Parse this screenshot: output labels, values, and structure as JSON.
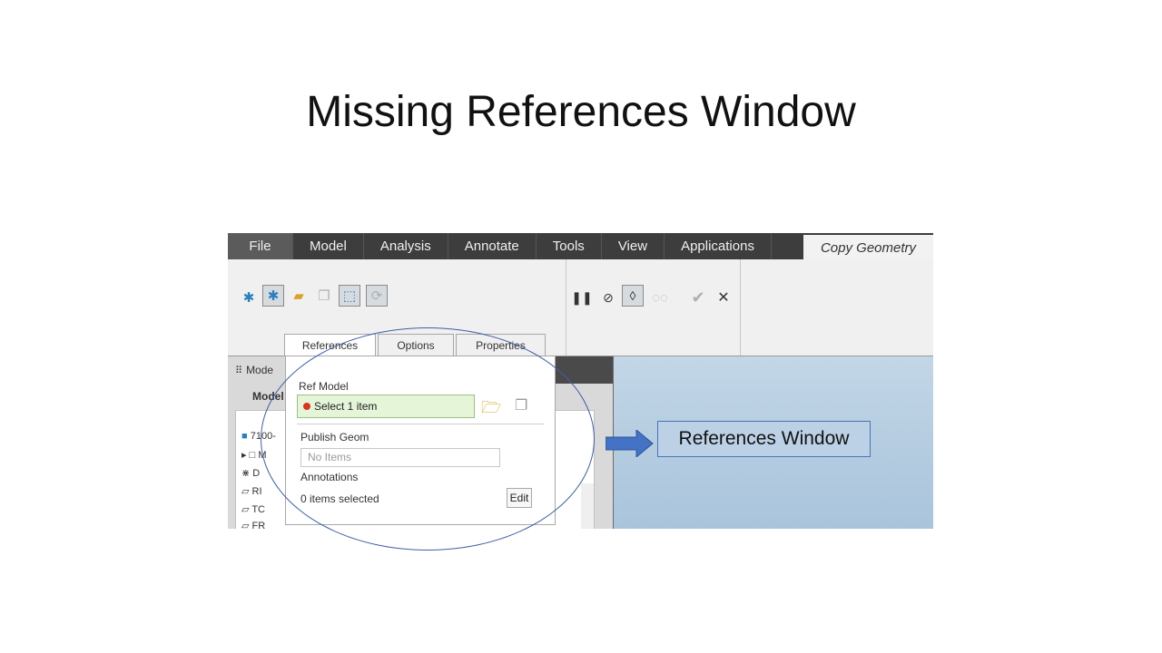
{
  "slide": {
    "title": "Missing References Window"
  },
  "menu": {
    "items": [
      "File",
      "Model",
      "Analysis",
      "Annotate",
      "Tools",
      "View",
      "Applications"
    ],
    "active": "Copy Geometry"
  },
  "ribbon": {
    "tabs": [
      "References",
      "Options",
      "Properties"
    ]
  },
  "tree": {
    "header": "Mode",
    "sub": "Model",
    "rows": [
      "7100-",
      "M",
      "D",
      "RI",
      "TC",
      "FR"
    ]
  },
  "ref_panel": {
    "ref_model_label": "Ref Model",
    "select_text": "Select 1 item",
    "publish_geom_label": "Publish Geom",
    "no_items_placeholder": "No Items",
    "annotations_label": "Annotations",
    "selected_count": "0 items selected",
    "edit_label": "Edit"
  },
  "callout": {
    "text": "References Window"
  },
  "colors": {
    "accent": "#3f5ea8",
    "menubar": "#3d3d3d",
    "select_bg": "#e4f5d8"
  }
}
